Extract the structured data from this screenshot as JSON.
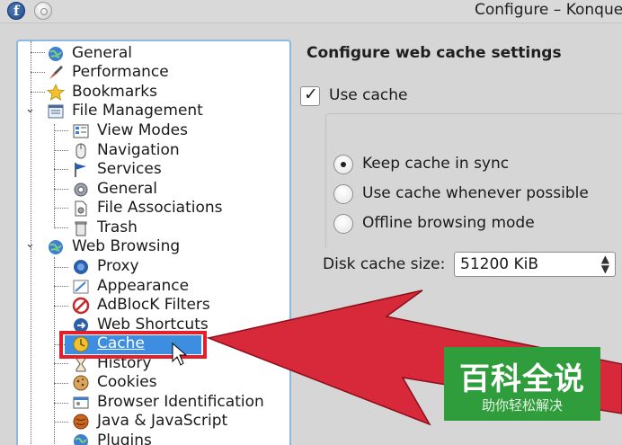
{
  "window": {
    "title": "Configure – Konque"
  },
  "tree": {
    "items": [
      {
        "label": "General",
        "icon": "globe-icon"
      },
      {
        "label": "Performance",
        "icon": "rocket-icon"
      },
      {
        "label": "Bookmarks",
        "icon": "star-icon"
      },
      {
        "label": "File Management",
        "icon": "file-manager-icon"
      },
      {
        "label": "View Modes",
        "icon": "view-modes-icon"
      },
      {
        "label": "Navigation",
        "icon": "mouse-icon"
      },
      {
        "label": "Services",
        "icon": "flag-icon"
      },
      {
        "label": "General",
        "icon": "gear-icon"
      },
      {
        "label": "File Associations",
        "icon": "document-gear-icon"
      },
      {
        "label": "Trash",
        "icon": "trash-icon"
      },
      {
        "label": "Web Browsing",
        "icon": "globe-icon"
      },
      {
        "label": "Proxy",
        "icon": "proxy-icon"
      },
      {
        "label": "Appearance",
        "icon": "appearance-icon"
      },
      {
        "label": "AdBlocK Filters",
        "icon": "no-entry-icon"
      },
      {
        "label": "Web Shortcuts",
        "icon": "web-shortcuts-icon"
      },
      {
        "label": "Cache",
        "icon": "cache-icon"
      },
      {
        "label": "History",
        "icon": "history-icon"
      },
      {
        "label": "Cookies",
        "icon": "cookie-icon"
      },
      {
        "label": "Browser Identification",
        "icon": "browser-id-icon"
      },
      {
        "label": "Java & JavaScript",
        "icon": "java-icon"
      },
      {
        "label": "Plugins",
        "icon": "plugin-icon"
      }
    ],
    "selected": "Cache",
    "highlight_color": "#e2202b"
  },
  "cache_settings": {
    "title": "Configure web cache settings",
    "use_cache_label": "Use cache",
    "use_cache_checked": true,
    "options": [
      {
        "label": "Keep cache in sync",
        "selected": true
      },
      {
        "label": "Use cache whenever possible",
        "selected": false
      },
      {
        "label": "Offline browsing mode",
        "selected": false
      }
    ],
    "disk_cache_label": "Disk cache size:",
    "disk_cache_value": "51200 KiB"
  },
  "watermark": {
    "main": "百科全说",
    "sub": "助你轻松解决",
    "color": "#2f9d3b"
  },
  "arrow_color": "#d8293a"
}
